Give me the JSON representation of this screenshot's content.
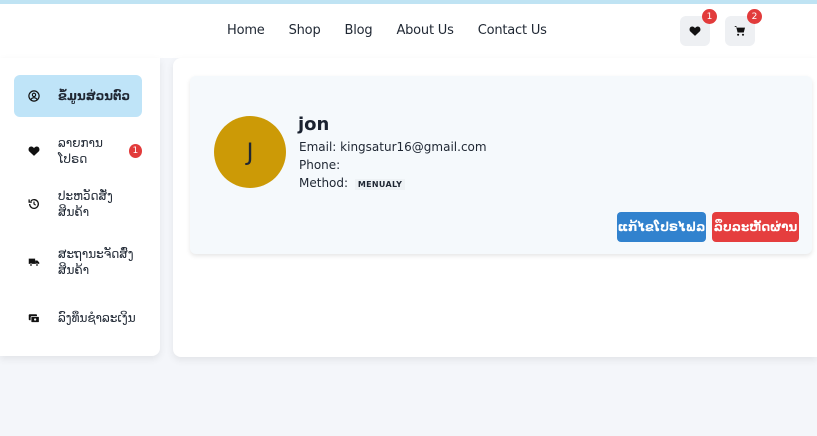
{
  "nav": {
    "items": [
      "Home",
      "Shop",
      "Blog",
      "About Us",
      "Contact Us"
    ]
  },
  "header_icons": {
    "wishlist": {
      "icon": "heart-icon",
      "count": "1"
    },
    "cart": {
      "icon": "cart-icon",
      "count": "2"
    }
  },
  "sidebar": {
    "items": [
      {
        "label": "ຂໍ້ມູນສ່ວນຕົວ",
        "icon": "user-circle-icon",
        "active": true
      },
      {
        "label": "ລາຍການໂປຣດ",
        "icon": "heart-icon",
        "badge": "1"
      },
      {
        "label": "ປະຫວັດສັ່ງສິນຄ້າ",
        "icon": "history-icon"
      },
      {
        "label": "ສະຖານະຈັດສົ່ງ\nສິນຄ້າ",
        "icon": "truck-icon"
      },
      {
        "label": "ລົງທຶນຊຳລະເງິນ",
        "icon": "payment-card-icon"
      }
    ]
  },
  "profile": {
    "avatar_letter": "J",
    "name": "jon",
    "email_label": "Email:",
    "email": "kingsatur16@gmail.com",
    "phone_label": "Phone:",
    "phone": "",
    "method_label": "Method:",
    "method": "MENUALY"
  },
  "buttons": {
    "edit_profile": "ແກ້ໄຂໂປຣໄຟລ",
    "delete_account": "ລຶບລະຫັດຜ່ານ"
  },
  "colors": {
    "accent_blue": "#3182ce",
    "danger_red": "#e53e3e",
    "active_item": "#bfe4f8",
    "avatar_bg": "#cc9a06"
  }
}
